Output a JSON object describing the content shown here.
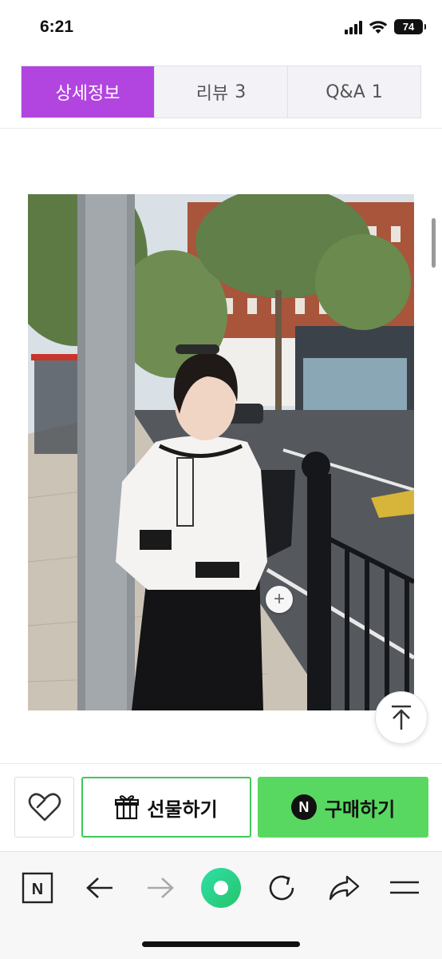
{
  "status_bar": {
    "time": "6:21",
    "battery": "74"
  },
  "tabs": [
    {
      "label": "상세정보",
      "count": "",
      "active": true
    },
    {
      "label": "리뷰",
      "count": "3",
      "active": false
    },
    {
      "label": "Q&A",
      "count": "1",
      "active": false
    }
  ],
  "product_image": {
    "zoom_label": "+"
  },
  "action_bar": {
    "wishlist_icon": "heart-icon",
    "gift_label": "선물하기",
    "gift_icon": "gift-icon",
    "buy_label": "구매하기",
    "buy_icon_text": "N",
    "buy_color": "#58d861",
    "accent_color": "#b245e0"
  },
  "browser_bar": {
    "items": [
      "naver-icon",
      "back-arrow-icon",
      "forward-arrow-icon",
      "green-dot-icon",
      "refresh-icon",
      "share-icon",
      "menu-icon"
    ],
    "naver_label": "N"
  }
}
